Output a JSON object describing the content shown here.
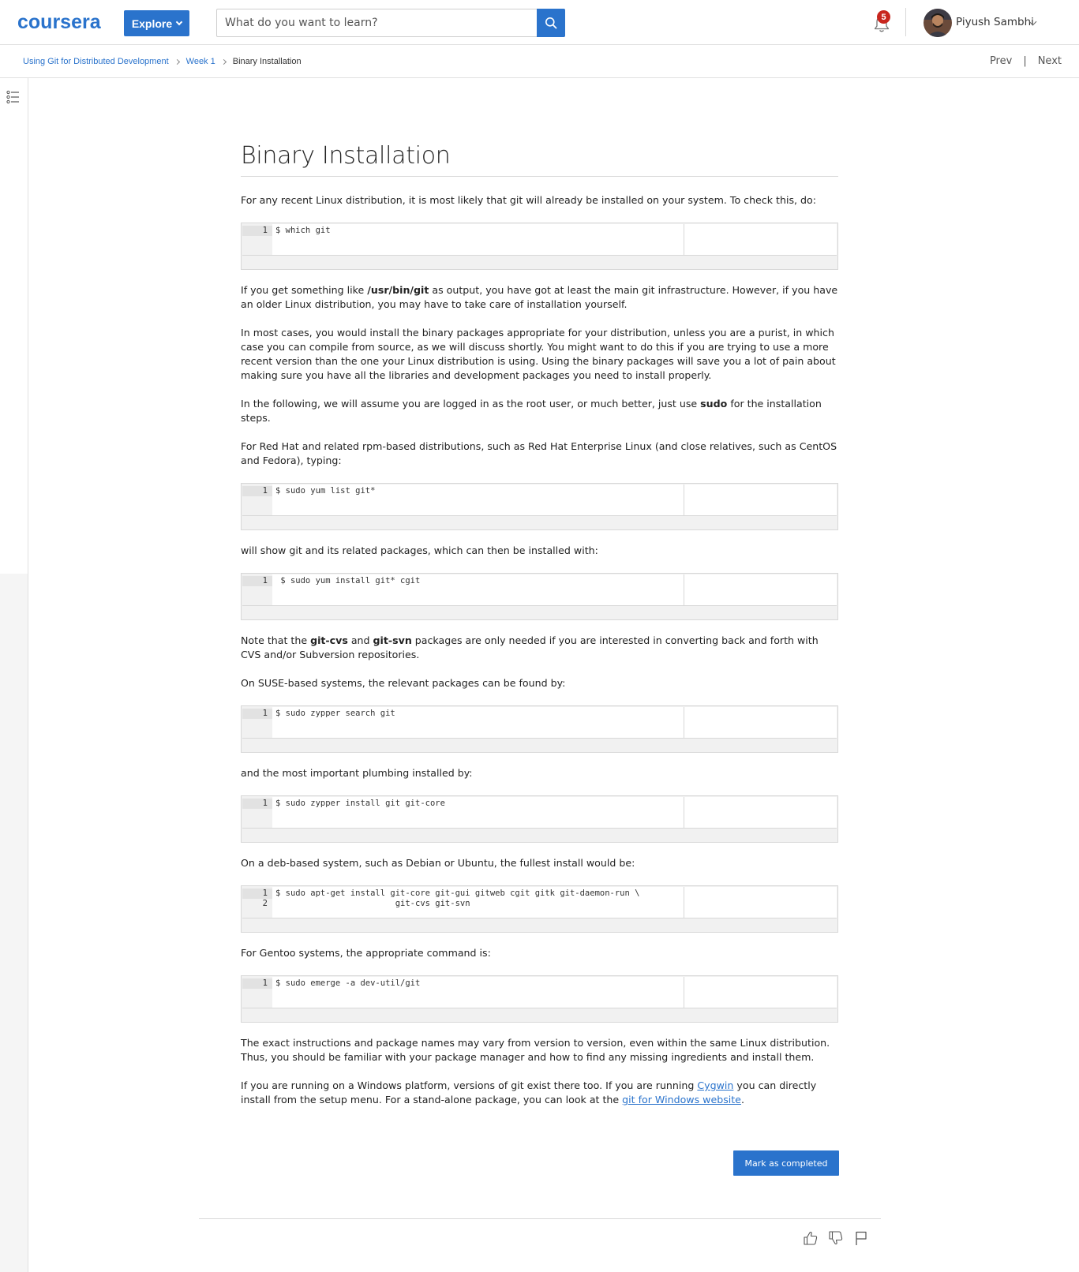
{
  "header": {
    "logo": "coursera",
    "explore_label": "Explore",
    "search_placeholder": "What do you want to learn?",
    "notification_count": "5",
    "user_name": "Piyush Sambhi"
  },
  "breadcrumb": {
    "items": [
      "Using Git for Distributed Development",
      "Week 1"
    ],
    "current": "Binary Installation",
    "prev_label": "Prev",
    "next_label": "Next",
    "separator": "|"
  },
  "content": {
    "title": "Binary Installation",
    "p1": "For any recent Linux distribution, it is most likely that git will already be installed on your system. To check this, do:",
    "code1": {
      "lines": [
        "$ which git"
      ]
    },
    "p2_a": "If you get something like ",
    "p2_b": "/usr/bin/git",
    "p2_c": " as output, you have got at least the main git infrastructure. However, if you have an older Linux distribution, you may have to take care of installation yourself.",
    "p3": "In most cases, you would install the binary packages appropriate for your distribution, unless you are a purist, in which case you can compile from source, as we will discuss shortly. You might want to do this if you are trying to use a more recent version than the one your Linux distribution is using. Using the binary packages will save you a lot of pain about making sure you have all the libraries and development packages you need to install properly.",
    "p4_a": "In the following, we will assume you are logged in as the root user, or much better, just use ",
    "p4_b": "sudo",
    "p4_c": " for the installation steps.",
    "p5": "For Red Hat and related rpm-based distributions, such as Red Hat Enterprise Linux (and close relatives, such as CentOS and Fedora), typing:",
    "code2": {
      "lines": [
        "$ sudo yum list git*"
      ]
    },
    "p6": "will show git and its related packages, which can then be installed with:",
    "code3": {
      "lines": [
        " $ sudo yum install git* cgit"
      ]
    },
    "p7_a": "Note that the ",
    "p7_b": "git-cvs",
    "p7_c": " and ",
    "p7_d": "git-svn",
    "p7_e": " packages are only needed if you are interested in converting back and forth with CVS and/or Subversion repositories.",
    "p8": "On SUSE-based systems, the relevant packages can be found by:",
    "code4": {
      "lines": [
        "$ sudo zypper search git"
      ]
    },
    "p9": "and the most important plumbing installed by:",
    "code5": {
      "lines": [
        "$ sudo zypper install git git-core"
      ]
    },
    "p10": "On a deb-based system, such as Debian or Ubuntu, the fullest install would be:",
    "code6": {
      "lines": [
        "$ sudo apt-get install git-core git-gui gitweb cgit gitk git-daemon-run \\",
        "                        git-cvs git-svn"
      ]
    },
    "p11": "For Gentoo systems, the appropriate command is:",
    "code7": {
      "lines": [
        "$ sudo emerge -a dev-util/git"
      ]
    },
    "p12": "The exact instructions and package names may vary from version to version, even within the same Linux distribution. Thus, you should be familiar with your package manager and how to find any missing ingredients and install them.",
    "p13_a": "If you are running on a Windows platform, versions of git exist there too. If you are running ",
    "p13_link1": "Cygwin",
    "p13_b": " you can directly install from the setup menu. For a stand-alone package, you can look at the ",
    "p13_link2": "git for Windows website",
    "p13_c": "."
  },
  "actions": {
    "mark_completed": "Mark as completed"
  },
  "colors": {
    "brand": "#2a73cc",
    "badge": "#c8261e"
  },
  "icons": [
    "search-icon",
    "bell-icon",
    "chevron-down-icon",
    "outline-list-icon",
    "thumbs-up-icon",
    "thumbs-down-icon",
    "flag-icon"
  ]
}
